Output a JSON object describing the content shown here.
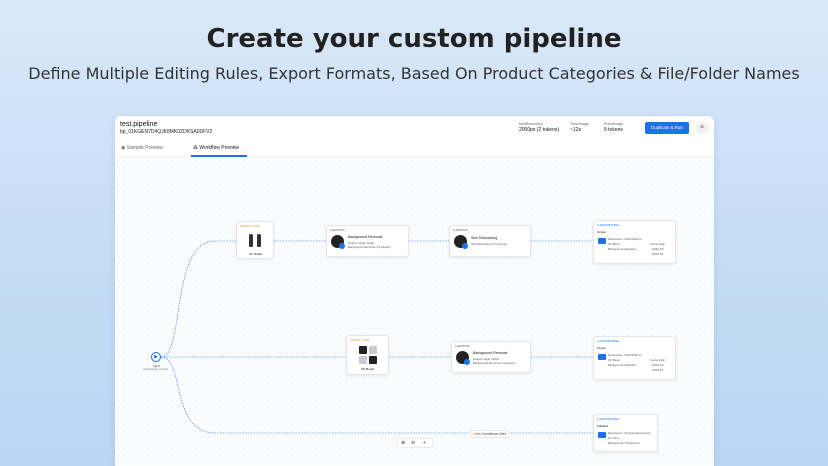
{
  "hero": {
    "title": "Create your custom pipeline",
    "subtitle": "Define Multiple Editing Rules, Export Formats, Based On Product Categories & File/Folder Names"
  },
  "header": {
    "pipeline_name": "test.pipeline",
    "pipeline_id": "bp_01KGEN7D4QJK8MK0ZDKSA0DFV2",
    "stats": [
      {
        "label": "MaxResolution",
        "value": "2000px (2 tokens)"
      },
      {
        "label": "Time/Image",
        "value": "~12s"
      },
      {
        "label": "Price/Image",
        "value": "5 tokens"
      }
    ],
    "duplicate_label": "Duplicate & Run",
    "close_label": "×"
  },
  "tabs": [
    {
      "label": "Sample Preview",
      "active": false
    },
    {
      "label": "Workflow Preview",
      "active": true
    }
  ],
  "nodes": {
    "input": {
      "label": "Input",
      "sub": "Upload Image or Folder"
    },
    "shot_type_top": {
      "tag": "● SHOT TYPE",
      "name": "On Model"
    },
    "shot_type_mid": {
      "tag": "● SHOT TYPE",
      "name": "Off Model"
    },
    "editing_bg_top": {
      "tag": "● EDITING",
      "title": "Background Removal",
      "lines": [
        "Output Image: Single",
        "Background Removal (1.0 tokens)"
      ]
    },
    "editing_skin": {
      "tag": "● EDITING",
      "title": "Skin Retouching",
      "lines": [
        "Skin Retouching (0.5 tokens)"
      ]
    },
    "editing_bg_mid": {
      "tag": "● EDITING",
      "title": "Background Removal",
      "lines": [
        "Output Image: Single",
        "Background Removal (1.0 tokens)"
      ]
    },
    "export_top": {
      "tag": "● EXPORTABLE",
      "title": "Output",
      "lines": [
        "Dimensions: 1000x1000 px",
        "Fit: Bleed",
        "Background: Standard",
        "Center align",
        "100% Fill",
        "100% Fit"
      ]
    },
    "export_mid": {
      "tag": "● EXPORTABLE",
      "title": "Output",
      "lines": [
        "Dimensions: 1000x1000 px",
        "Fit: Bleed",
        "Background: Standard",
        "Center align",
        "100% Fill",
        "100% Fit"
      ]
    },
    "export_bottom": {
      "tag": "● EXPORTABLE",
      "title": "Fallback",
      "lines": [
        "Dimensions: (Original dimensions)",
        "Fit: None",
        "Background: Transparent"
      ]
    }
  },
  "no_conditions": "No Conditions Met",
  "zoom": {
    "zoom_in": "⊕",
    "zoom_out": "⊖",
    "fit": "+"
  },
  "colors": {
    "accent": "#1a73e8",
    "shot_tag": "#e08a1c"
  }
}
